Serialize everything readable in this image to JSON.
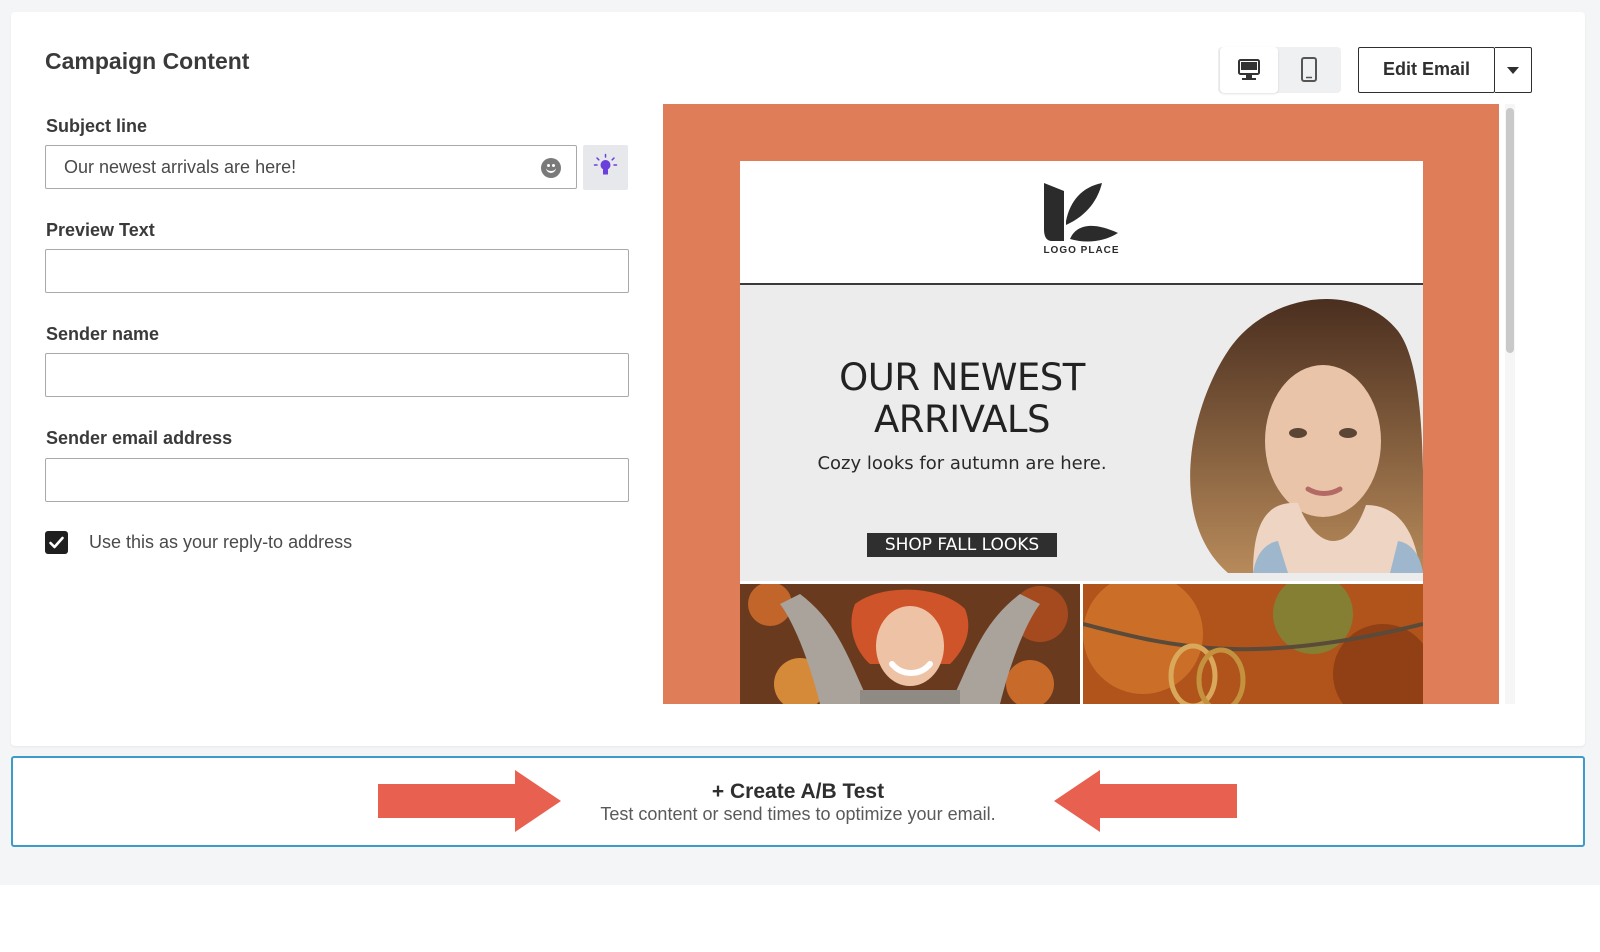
{
  "campaign": {
    "title": "Campaign Content"
  },
  "form": {
    "subject_label": "Subject line",
    "subject_value": "Our newest arrivals are here!",
    "preview_label": "Preview Text",
    "preview_value": "",
    "sender_name_label": "Sender name",
    "sender_name_value": "",
    "sender_email_label": "Sender email address",
    "sender_email_value": "",
    "reply_to_label": "Use this as your reply-to address",
    "reply_to_checked": true
  },
  "toolbar": {
    "edit_email_label": "Edit Email",
    "views": [
      "desktop-icon",
      "mobile-icon"
    ],
    "active_view": "desktop"
  },
  "email_preview": {
    "logo_text": "LOGO PLACE",
    "hero_title": "OUR NEWEST ARRIVALS",
    "hero_subtitle": "Cozy looks for autumn are here.",
    "cta_label": "SHOP FALL LOOKS",
    "background_color": "#e07d59"
  },
  "ab_test": {
    "title": "+ Create A/B Test",
    "subtitle": "Test content or send times to optimize your email.",
    "border_color": "#3d9ac9",
    "arrow_color": "#e8604f"
  }
}
